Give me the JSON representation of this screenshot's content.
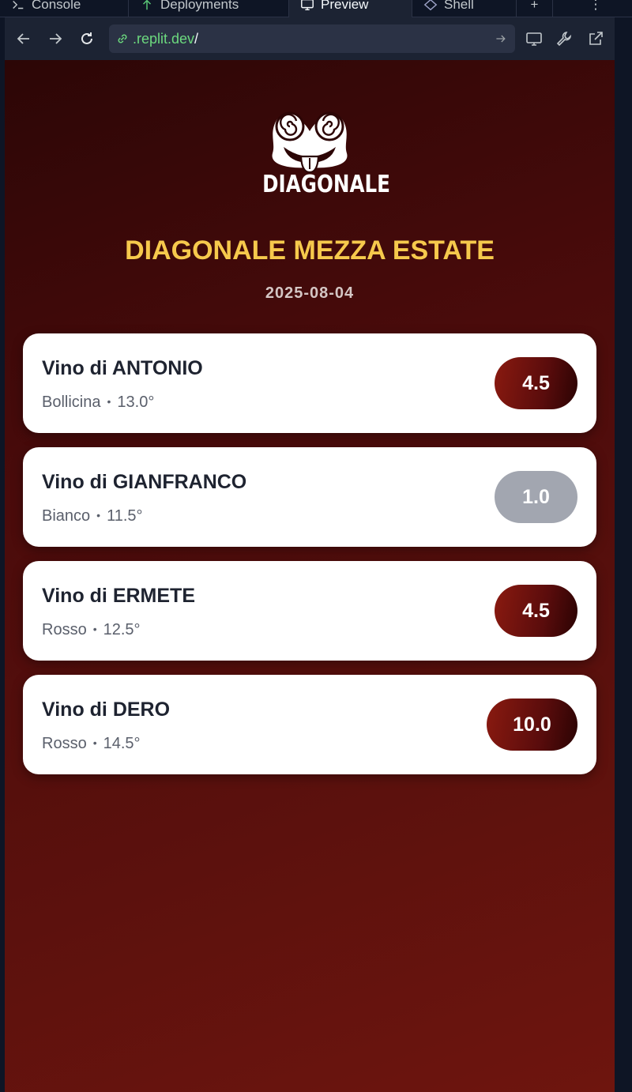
{
  "ide": {
    "tabs": [
      {
        "label": "Console",
        "icon": "terminal-icon"
      },
      {
        "label": "Deployments",
        "icon": "deploy-icon"
      },
      {
        "label": "Preview",
        "icon": "monitor-icon"
      },
      {
        "label": "Shell",
        "icon": "shell-icon"
      }
    ],
    "add_tab": "+",
    "more": "⋮",
    "url": {
      "domain": ".replit.dev",
      "path": "/"
    }
  },
  "app": {
    "brand": "DIAGONALE",
    "event_title": "DIAGONALE MEZZA ESTATE",
    "date": "2025-08-04",
    "wines": [
      {
        "name": "Vino di ANTONIO",
        "type": "Bollicina",
        "abv": "13.0°",
        "score": "4.5"
      },
      {
        "name": "Vino di GIANFRANCO",
        "type": "Bianco",
        "abv": "11.5°",
        "score": "1.0"
      },
      {
        "name": "Vino di ERMETE",
        "type": "Rosso",
        "abv": "12.5°",
        "score": "4.5"
      },
      {
        "name": "Vino di DERO",
        "type": "Rosso",
        "abv": "14.5°",
        "score": "10.0"
      }
    ],
    "colors": {
      "title": "#f6c94c",
      "score_high": "#6e0f0d",
      "score_low": "#a2a6b0",
      "background": "#4a0b0b"
    }
  }
}
